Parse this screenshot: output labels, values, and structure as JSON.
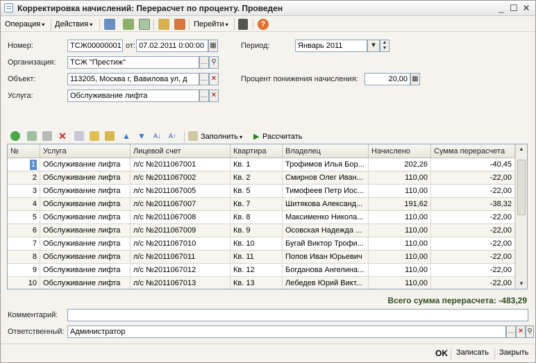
{
  "window": {
    "title": "Корректировка начислений: Перерасчет по проценту. Проведен",
    "minimize": "_",
    "maximize": "☐",
    "close": "✕"
  },
  "toolbar": {
    "operation": "Операция",
    "actions": "Действия",
    "goto": "Перейти",
    "arrow": "▾"
  },
  "form": {
    "number_label": "Номер:",
    "number_value": "ТСЖ00000001",
    "from_label": "от:",
    "date_value": "07.02.2011  0:00:00",
    "period_label": "Период:",
    "period_value": "Январь 2011",
    "org_label": "Организация:",
    "org_value": "ТСЖ \"Престиж\"",
    "object_label": "Объект:",
    "object_value": "113205, Москва г, Вавилова ул, д",
    "percent_label": "Процент понижения начисления:",
    "percent_value": "20,00",
    "service_label": "Услуга:",
    "service_value": "Обслуживание лифта"
  },
  "grid_toolbar": {
    "fill": "Заполнить",
    "calculate": "Рассчитать"
  },
  "table": {
    "columns": [
      "№",
      "Услуга",
      "Лицевой счет",
      "Квартира",
      "Владелец",
      "Начислено",
      "Сумма перерасчета"
    ],
    "rows": [
      [
        "1",
        "Обслуживание лифта",
        "л/с №2011067001",
        "Кв. 1",
        "Трофимов Илья Бор...",
        "202,26",
        "-40,45"
      ],
      [
        "2",
        "Обслуживание лифта",
        "л/с №2011067002",
        "Кв. 2",
        "Смирнов Олег Иван...",
        "110,00",
        "-22,00"
      ],
      [
        "3",
        "Обслуживание лифта",
        "л/с №2011067005",
        "Кв. 5",
        "Тимофеев Петр Иос...",
        "110,00",
        "-22,00"
      ],
      [
        "4",
        "Обслуживание лифта",
        "л/с №2011067007",
        "Кв. 7",
        "Шитякова Александ...",
        "191,62",
        "-38,32"
      ],
      [
        "5",
        "Обслуживание лифта",
        "л/с №2011067008",
        "Кв. 8",
        "Максименко Никола...",
        "110,00",
        "-22,00"
      ],
      [
        "6",
        "Обслуживание лифта",
        "л/с №2011067009",
        "Кв. 9",
        "Осовская Надежда ...",
        "110,00",
        "-22,00"
      ],
      [
        "7",
        "Обслуживание лифта",
        "л/с №2011067010",
        "Кв. 10",
        "Бугай Виктор Трофи...",
        "110,00",
        "-22,00"
      ],
      [
        "8",
        "Обслуживание лифта",
        "л/с №2011067011",
        "Кв. 11",
        "Попов Иван Юрьевич",
        "110,00",
        "-22,00"
      ],
      [
        "9",
        "Обслуживание лифта",
        "л/с №2011067012",
        "Кв. 12",
        "Богданова Ангелина...",
        "110,00",
        "-22,00"
      ],
      [
        "10",
        "Обслуживание лифта",
        "л/с №2011067013",
        "Кв. 13",
        "Лебедев Юрий Викт...",
        "110,00",
        "-22,00"
      ]
    ]
  },
  "total": "Всего сумма перерасчета: -483,29",
  "comment_label": "Комментарий:",
  "comment_value": "",
  "responsible_label": "Ответственный:",
  "responsible_value": "Администратор",
  "buttons": {
    "ok": "OK",
    "save": "Записать",
    "close": "Закрыть"
  },
  "colors": {
    "selection": "#5a8fd0",
    "total_text": "#2f4f1f",
    "calc_icon": "#1a8a1a"
  }
}
